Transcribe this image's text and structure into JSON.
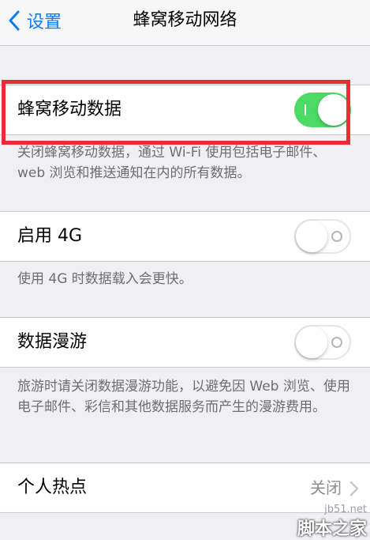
{
  "nav": {
    "back_label": "设置",
    "title": "蜂窝移动网络"
  },
  "cellular_data": {
    "label": "蜂窝移动数据",
    "enabled": true,
    "footnote": "关闭蜂窝移动数据，通过 Wi-Fi 使用包括电子邮件、web 浏览和推送通知在内的所有数据。"
  },
  "enable_4g": {
    "label": "启用 4G",
    "enabled": false,
    "footnote": "使用 4G 时数据载入会更快。"
  },
  "data_roaming": {
    "label": "数据漫游",
    "enabled": false,
    "footnote": "旅游时请关闭数据漫游功能，以避免因 Web 浏览、使用电子邮件、彩信和其他数据服务而产生的漫游费用。"
  },
  "hotspot": {
    "label": "个人热点",
    "value": "关闭"
  },
  "watermark": {
    "url": "jb51.net",
    "name": "脚本之家"
  },
  "colors": {
    "accent": "#0a7aff",
    "toggle_on": "#4cd964",
    "highlight": "#ee2a34",
    "background": "#efeff4"
  },
  "icons": {
    "back": "chevron-left-icon",
    "disclosure": "chevron-right-icon"
  }
}
